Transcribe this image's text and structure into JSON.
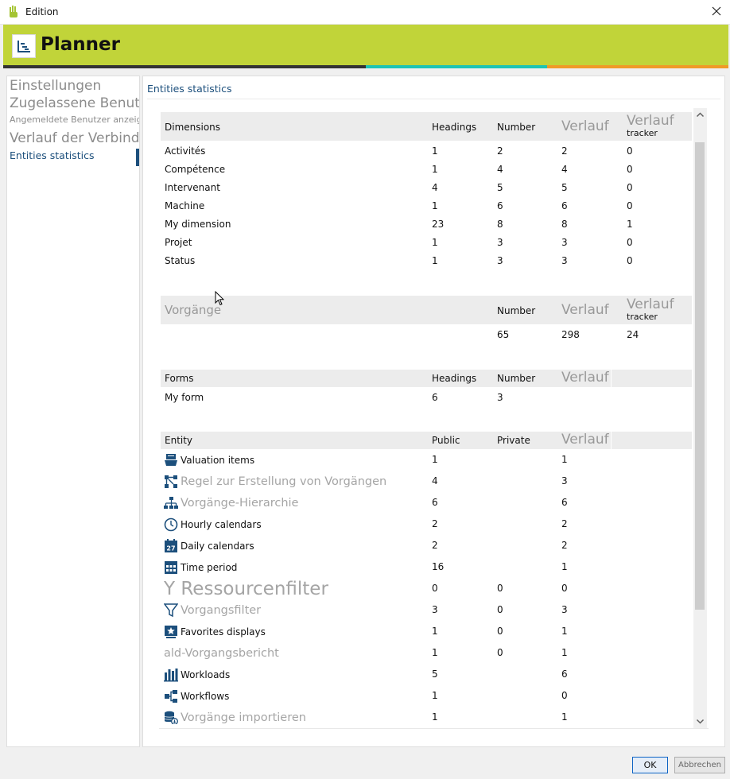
{
  "window": {
    "title": "Edition"
  },
  "banner": {
    "title": "Planner"
  },
  "colors": {
    "banner": "#c1d439",
    "stripe_dark": "#333333",
    "stripe_cyan": "#1cc4b4",
    "stripe_orange": "#f09a27",
    "accent": "#1c4f7c"
  },
  "sidebar": {
    "items": [
      {
        "label": "Einstellungen"
      },
      {
        "label": "Zugelassene Benutzer/Gruppen"
      },
      {
        "label": "Angemeldete Benutzer anzeigen"
      },
      {
        "label": "Verlauf der Verbindung"
      },
      {
        "label": "Entities statistics"
      }
    ]
  },
  "panel": {
    "heading": "Entities statistics"
  },
  "dimensions": {
    "headers": {
      "name": "Dimensions",
      "headings": "Headings",
      "number": "Number",
      "verlauf": "Verlauf",
      "verlauf2": "Verlauf",
      "tracker": "tracker"
    },
    "rows": [
      {
        "name": "Activités",
        "headings": "1",
        "number": "2",
        "verlauf": "2",
        "tracker": "0"
      },
      {
        "name": "Compétence",
        "headings": "1",
        "number": "4",
        "verlauf": "4",
        "tracker": "0"
      },
      {
        "name": "Intervenant",
        "headings": "4",
        "number": "5",
        "verlauf": "5",
        "tracker": "0"
      },
      {
        "name": "Machine",
        "headings": "1",
        "number": "6",
        "verlauf": "6",
        "tracker": "0"
      },
      {
        "name": "My dimension",
        "headings": "23",
        "number": "8",
        "verlauf": "8",
        "tracker": "1"
      },
      {
        "name": "Projet",
        "headings": "1",
        "number": "3",
        "verlauf": "3",
        "tracker": "0"
      },
      {
        "name": "Status",
        "headings": "1",
        "number": "3",
        "verlauf": "3",
        "tracker": "0"
      }
    ]
  },
  "vorgaenge": {
    "headers": {
      "name": "Vorgänge",
      "number": "Number",
      "verlauf": "Verlauf",
      "verlauf2": "Verlauf",
      "tracker": "tracker"
    },
    "row": {
      "number": "65",
      "verlauf": "298",
      "tracker": "24"
    }
  },
  "forms": {
    "headers": {
      "name": "Forms",
      "headings": "Headings",
      "number": "Number",
      "verlauf": "Verlauf"
    },
    "rows": [
      {
        "name": "My form",
        "headings": "6",
        "number": "3"
      }
    ]
  },
  "entities": {
    "headers": {
      "name": "Entity",
      "public": "Public",
      "private": "Private",
      "verlauf": "Verlauf"
    },
    "rows": [
      {
        "name": "Valuation items",
        "public": "1",
        "private": "",
        "verlauf": "1"
      },
      {
        "name": "Regel zur Erstellung von Vorgängen",
        "public": "4",
        "private": "",
        "verlauf": "3"
      },
      {
        "name": "Vorgänge-Hierarchie",
        "public": "6",
        "private": "",
        "verlauf": "6"
      },
      {
        "name": "Hourly calendars",
        "public": "2",
        "private": "",
        "verlauf": "2"
      },
      {
        "name": "Daily calendars",
        "public": "2",
        "private": "",
        "verlauf": "2"
      },
      {
        "name": "Time period",
        "public": "16",
        "private": "",
        "verlauf": "1"
      },
      {
        "name": "Y Ressourcenfilter",
        "public": "0",
        "private": "0",
        "verlauf": "0"
      },
      {
        "name": "Vorgangsfilter",
        "public": "3",
        "private": "0",
        "verlauf": "3"
      },
      {
        "name": "Favorites displays",
        "public": "1",
        "private": "0",
        "verlauf": "1"
      },
      {
        "name": "ald-Vorgangsbericht",
        "public": "1",
        "private": "0",
        "verlauf": "1"
      },
      {
        "name": "Workloads",
        "public": "5",
        "private": "",
        "verlauf": "6"
      },
      {
        "name": "Workflows",
        "public": "1",
        "private": "",
        "verlauf": "0"
      },
      {
        "name": "Vorgänge importieren",
        "public": "1",
        "private": "",
        "verlauf": "1"
      }
    ]
  },
  "buttons": {
    "ok": "OK",
    "cancel": "Abbrechen"
  }
}
